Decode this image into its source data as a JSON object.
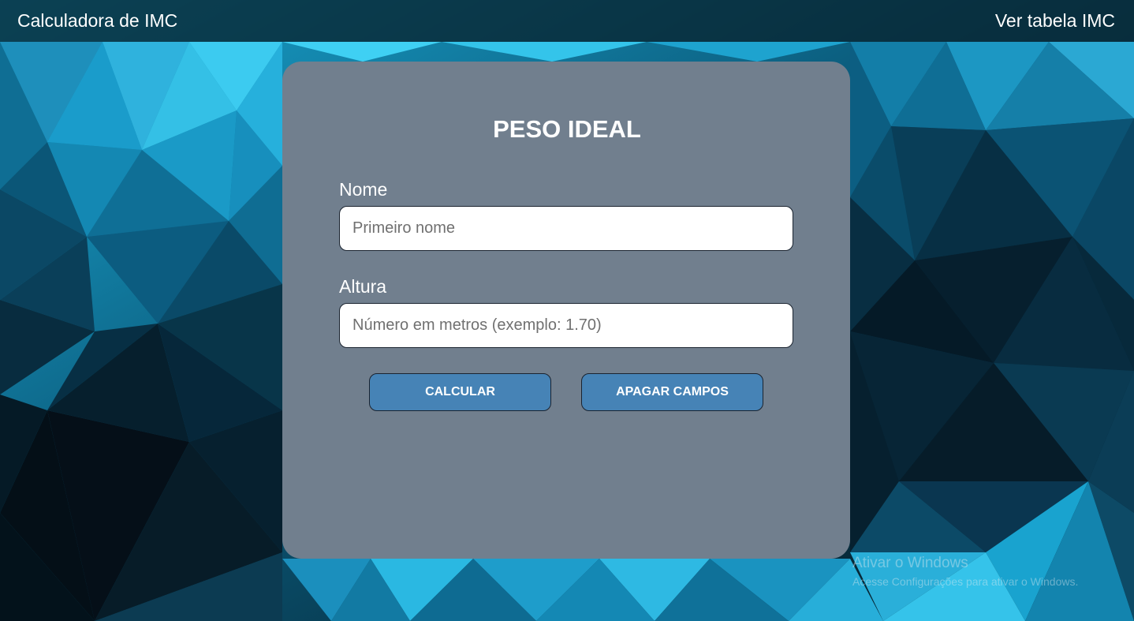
{
  "header": {
    "title": "Calculadora de IMC",
    "table_link": "Ver tabela IMC"
  },
  "form": {
    "title": "PESO IDEAL",
    "name_label": "Nome",
    "name_placeholder": "Primeiro nome",
    "name_value": "",
    "height_label": "Altura",
    "height_placeholder": "Número em metros (exemplo: 1.70)",
    "height_value": "",
    "calculate_label": "CALCULAR",
    "clear_label": "APAGAR CAMPOS"
  },
  "watermark": {
    "title": "Ativar o Windows",
    "subtitle": "Acesse Configurações para ativar o Windows."
  },
  "colors": {
    "card_background": "#717f8e",
    "button_background": "#4683b6",
    "topbar_background": "#0b2936",
    "background_light": "#2bc1e6",
    "background_dark": "#071823"
  }
}
